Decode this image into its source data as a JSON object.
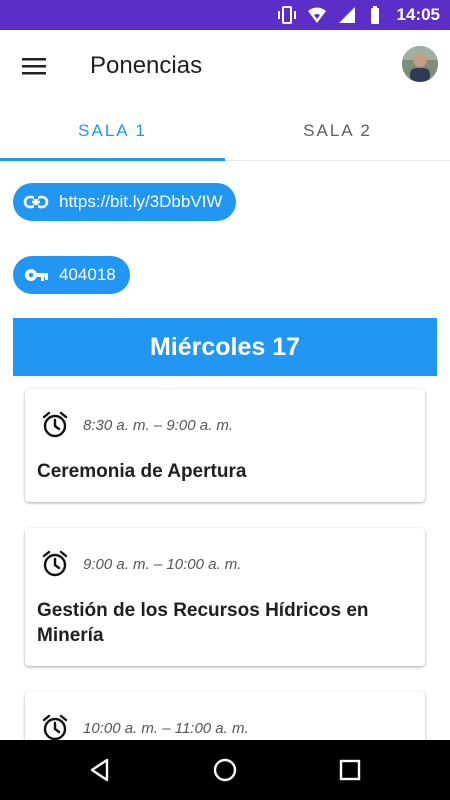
{
  "status_bar": {
    "time": "14:05",
    "icons": [
      "vibrate-icon",
      "wifi-icon",
      "signal-icon",
      "battery-icon"
    ]
  },
  "app_bar": {
    "title": "Ponencias",
    "menu_icon": "menu-icon",
    "avatar": "user-avatar"
  },
  "tabs": [
    {
      "label": "SALA 1",
      "active": true
    },
    {
      "label": "SALA 2",
      "active": false
    }
  ],
  "chips": {
    "link": {
      "icon": "link-icon",
      "text": "https://bit.ly/3DbbVIW"
    },
    "key": {
      "icon": "key-icon",
      "text": "404018"
    }
  },
  "day": {
    "label": "Miércoles 17"
  },
  "sessions": [
    {
      "time": "8:30 a. m. – 9:00 a. m.",
      "title": "Ceremonia de Apertura"
    },
    {
      "time": "9:00 a. m. – 10:00 a. m.",
      "title": "Gestión de los Recursos Hídricos en Minería"
    },
    {
      "time": "10:00 a. m. – 11:00 a. m.",
      "title": ""
    }
  ],
  "nav_bar": {
    "buttons": [
      "back-icon",
      "home-icon",
      "recents-icon"
    ]
  },
  "colors": {
    "status_bar": "#5b2fc7",
    "accent": "#2196f3",
    "tab_inactive": "#5f5f5f",
    "nav_bar": "#000000"
  }
}
